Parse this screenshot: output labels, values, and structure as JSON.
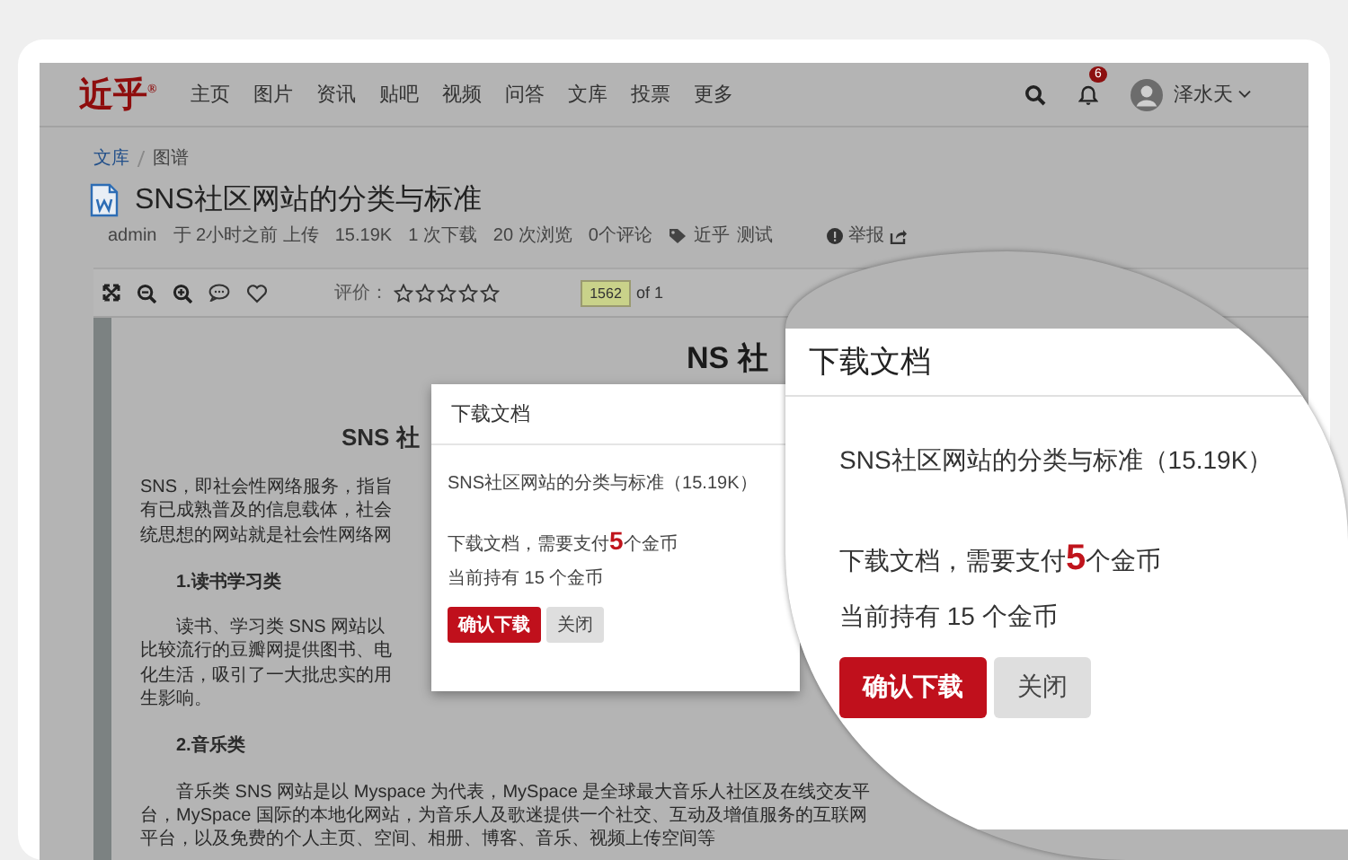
{
  "header": {
    "logo": "近乎$^{®}$",
    "nav": [
      "主页",
      "图片",
      "资讯",
      "贴吧",
      "视频",
      "问答",
      "文库",
      "投票",
      "更多"
    ],
    "notifications": "6",
    "user": "泽水天"
  },
  "breadcrumb": [
    {
      "label": "文库",
      "kind": "link"
    },
    {
      "label": "图谱",
      "kind": "current"
    }
  ],
  "document": {
    "title": "SNS社区网站的分类与标准",
    "meta": [
      "admin",
      "于 2小时之前 上传",
      "15.19K",
      "1 次下载",
      "20 次浏览",
      "0个评论"
    ],
    "tags": [
      "近乎",
      "测试"
    ],
    "report": "举报"
  },
  "viewer": {
    "rating_label": "评价：",
    "stars": 0,
    "page": "1562",
    "page_total": "of 1",
    "ghost_title": "NS 社",
    "lines": [
      {
        "kind": "heading",
        "text": "SNS 社"
      },
      {
        "kind": "line",
        "text": "SNS，即社会性网络服务，指旨"
      },
      {
        "kind": "line",
        "text": "有已成熟普及的信息载体，社会"
      },
      {
        "kind": "line",
        "text": "统思想的网站就是社会性网络网"
      },
      {
        "kind": "subheading",
        "text": "1.读书学习类"
      },
      {
        "kind": "indent",
        "text": "读书、学习类 SNS 网站以"
      },
      {
        "kind": "line",
        "text": "比较流行的豆瓣网提供图书、电"
      },
      {
        "kind": "line",
        "text": "化生活，吸引了一大批忠实的用"
      },
      {
        "kind": "line",
        "text": "生影响。"
      },
      {
        "kind": "subheading",
        "text": "2.音乐类"
      },
      {
        "kind": "indent",
        "text": "音乐类 SNS 网站是以 Myspace 为代表，MySpace 是全球最大音乐人社区及在线交友平"
      },
      {
        "kind": "line",
        "text": "台，MySpace 国际的本地化网站，为音乐人及歌迷提供一个社交、互动及增值服务的互联网"
      },
      {
        "kind": "line",
        "text": "平台，以及免费的个人主页、空间、相册、博客、音乐、视频上传空间等"
      }
    ]
  },
  "dialog": {
    "title": "下载文档",
    "file": "SNS社区网站的分类与标准（15.19K）",
    "pay": "下载文档，需要支付**5**个金币",
    "hold": "当前持有 15 个金币",
    "buttons": [
      {
        "label": "确认下载",
        "kind": "primary"
      },
      {
        "label": "关闭",
        "kind": "secondary"
      }
    ]
  },
  "magnifier": {
    "title": "下载文档",
    "file": "SNS社区网站的分类与标准（15.19K）",
    "pay": "下载文档，需要支付**5**个金币",
    "hold": "当前持有 15 个金币",
    "buttons": [
      {
        "label": "确认下载",
        "kind": "primary"
      },
      {
        "label": "关闭",
        "kind": "secondary"
      }
    ]
  }
}
